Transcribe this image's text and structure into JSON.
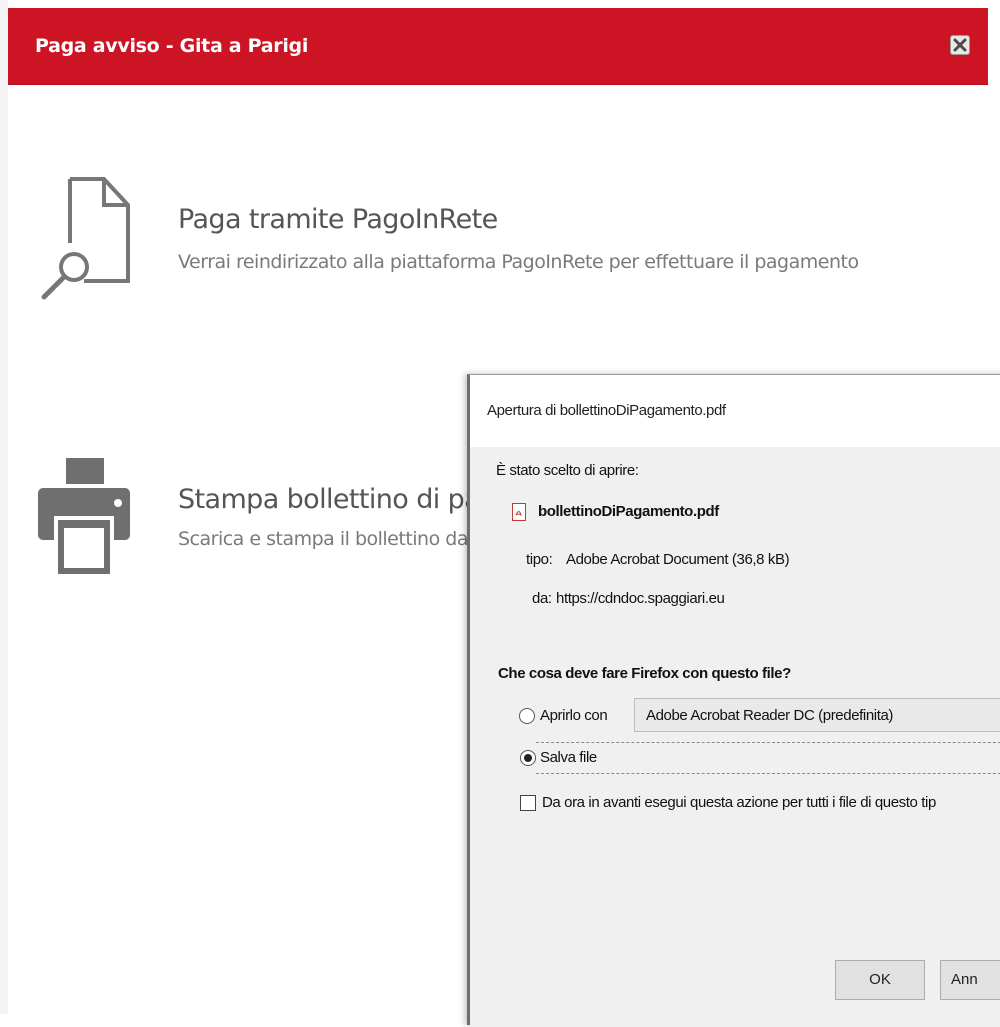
{
  "modal": {
    "title": "Paga avviso - Gita a Parigi",
    "close_icon": "close-x-icon",
    "accent_color": "#cc1424"
  },
  "options": [
    {
      "icon": "document-search-icon",
      "title": "Paga tramite PagoInRete",
      "description": "Verrai reindirizzato alla piattaforma PagoInRete per effettuare il pagamento"
    },
    {
      "icon": "printer-icon",
      "title": "Stampa bollettino di pag",
      "description": "Scarica e stampa il bollettino da"
    }
  ],
  "dialog": {
    "title": "Apertura di bollettinoDiPagamento.pdf",
    "intro": "È stato scelto di aprire:",
    "file_icon": "pdf-file-icon",
    "filename": "bollettinoDiPagamento.pdf",
    "type_label": "tipo:",
    "type_value": "Adobe Acrobat Document (36,8 kB)",
    "from_label": "da:",
    "from_value": "https://cdndoc.spaggiari.eu",
    "question": "Che cosa deve fare Firefox con questo file?",
    "open_with_label": "Aprirlo con",
    "open_with_app": "Adobe Acrobat Reader DC (predefinita)",
    "save_file_label": "Salva file",
    "selected_option": "save_file",
    "remember_label": "Da ora in avanti esegui questa azione per tutti i file di questo tip",
    "remember_checked": false,
    "ok_label": "OK",
    "cancel_label": "Ann"
  }
}
